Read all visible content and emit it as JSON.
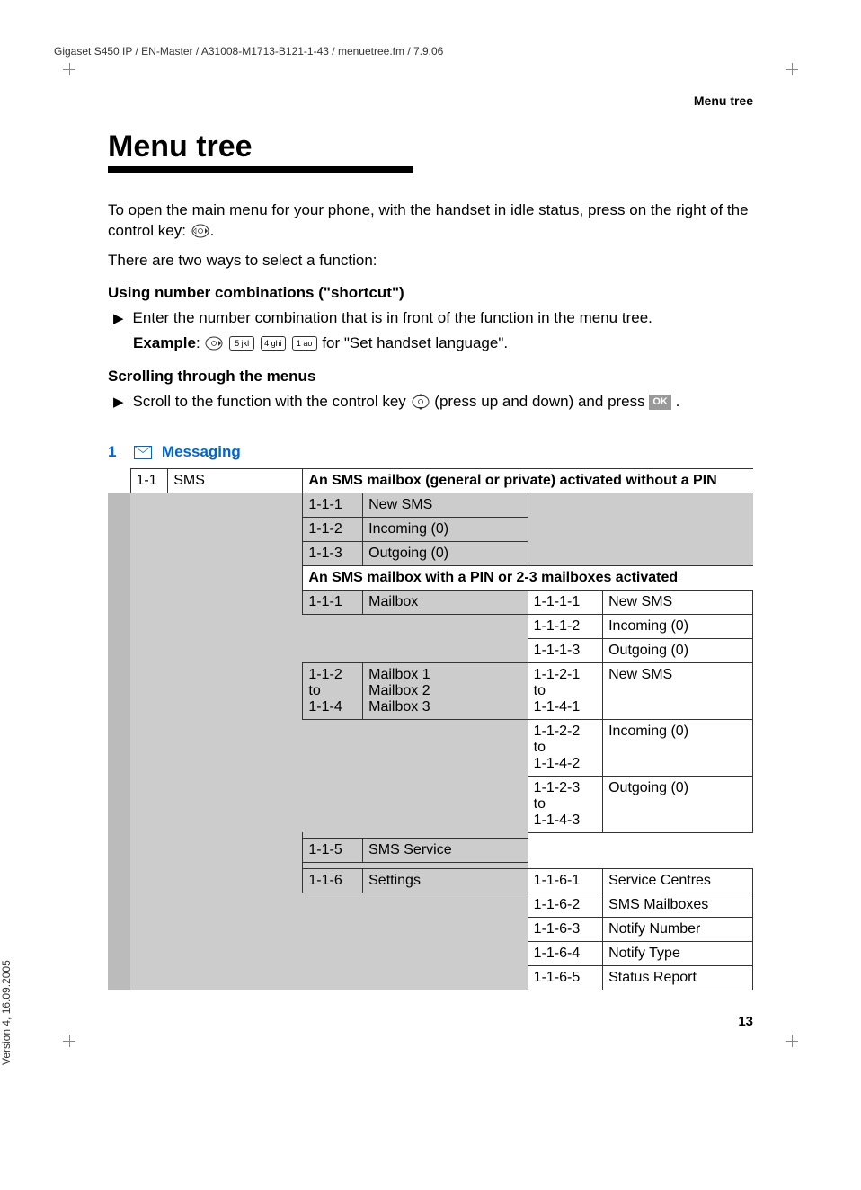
{
  "header_path": "Gigaset S450 IP / EN-Master / A31008-M1713-B121-1-43 / menuetree.fm / 7.9.06",
  "section_label": "Menu tree",
  "main_heading": "Menu tree",
  "intro_text": "To open the main menu for your phone, with the handset in idle status, press on the right of the control key: ",
  "intro_text_2": "There are two ways to select a function:",
  "sub1": "Using number combinations (\"shortcut\")",
  "sub1_bullet": "Enter the number combination that is in front of the function in the menu tree.",
  "example_label": "Example",
  "example_text": " for \"Set handset language\".",
  "sub2": "Scrolling through the menus",
  "sub2_bullet_a": "Scroll to the function with the control key ",
  "sub2_bullet_b": " (press up and down) and press ",
  "sub2_bullet_c": ".",
  "key_5": "5 jkl",
  "key_4": "4 ghi",
  "key_1": "1 ao",
  "ok_label": "OK",
  "section_num": "1",
  "section_icon_title": "Messaging",
  "table": {
    "r1_code": "1-1",
    "r1_name": "SMS",
    "r1_header": "An SMS mailbox (general or private) activated without a PIN",
    "r2_code": "1-1-1",
    "r2_name": "New SMS",
    "r3_code": "1-1-2",
    "r3_name": "Incoming (0)",
    "r4_code": "1-1-3",
    "r4_name": "Outgoing  (0)",
    "r5_header": "An SMS mailbox with a PIN or 2-3 mailboxes activated",
    "r6_code": "1-1-1",
    "r6_name": "Mailbox",
    "r6_sub_code": "1-1-1-1",
    "r6_sub_name": "New SMS",
    "r7_sub_code": "1-1-1-2",
    "r7_sub_name": "Incoming (0)",
    "r8_sub_code": "1-1-1-3",
    "r8_sub_name": "Outgoing  (0)",
    "r9_code_a": "1-1-2",
    "r9_code_b": "to",
    "r9_code_c": "1-1-4",
    "r9_name_a": "Mailbox 1",
    "r9_name_b": "Mailbox 2",
    "r9_name_c": "Mailbox 3",
    "r9_sub_code_a": "1-1-2-1",
    "r9_sub_code_b": "to",
    "r9_sub_code_c": "1-1-4-1",
    "r9_sub_name": "New SMS",
    "r10_sub_code_a": "1-1-2-2",
    "r10_sub_code_b": "to",
    "r10_sub_code_c": "1-1-4-2",
    "r10_sub_name": "Incoming (0)",
    "r11_sub_code_a": "1-1-2-3",
    "r11_sub_code_b": "to",
    "r11_sub_code_c": "1-1-4-3",
    "r11_sub_name": "Outgoing  (0)",
    "r12_code": "1-1-5",
    "r12_name": "SMS Service",
    "r13_code": "1-1-6",
    "r13_name": "Settings",
    "r13_sub_code": "1-1-6-1",
    "r13_sub_name": "Service Centres",
    "r14_sub_code": "1-1-6-2",
    "r14_sub_name": "SMS Mailboxes",
    "r15_sub_code": "1-1-6-3",
    "r15_sub_name": "Notify Number",
    "r16_sub_code": "1-1-6-4",
    "r16_sub_name": "Notify Type",
    "r17_sub_code": "1-1-6-5",
    "r17_sub_name": "Status Report"
  },
  "page_num": "13",
  "side_label": "Version 4, 16.09.2005"
}
